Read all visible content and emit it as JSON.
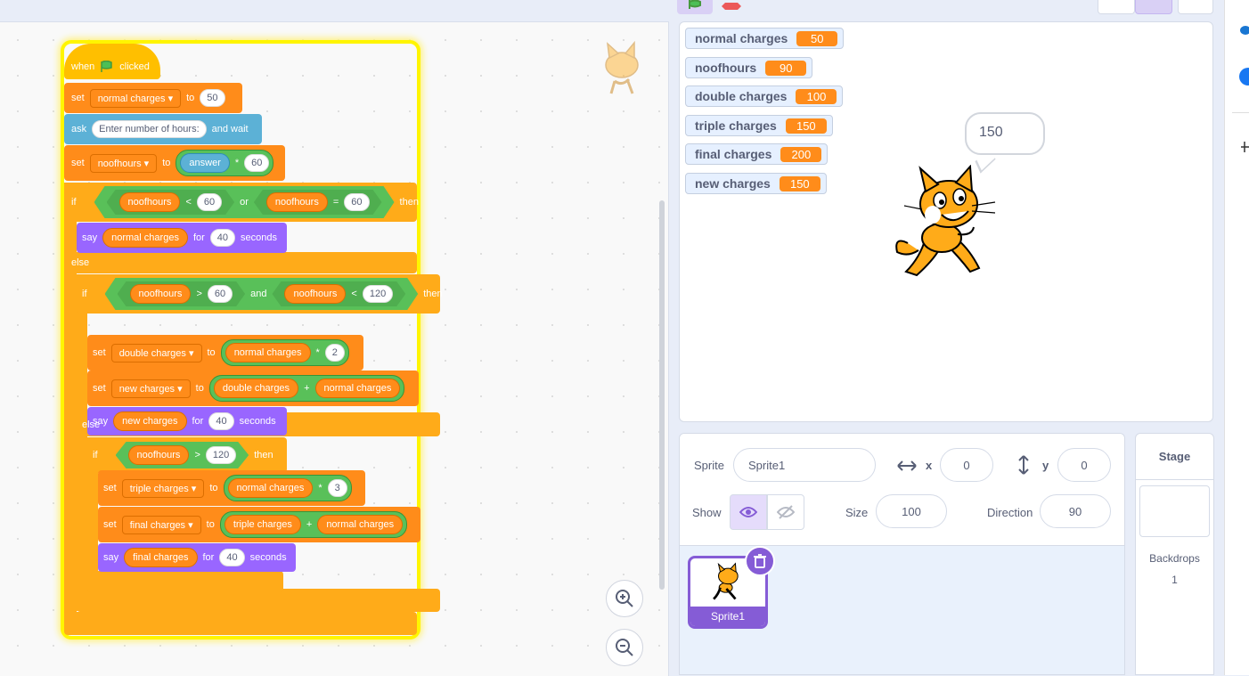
{
  "script": {
    "hat_when": "when",
    "hat_clicked": "clicked",
    "set_kw": "set",
    "to_kw": "to",
    "ask_kw": "ask",
    "and_wait": "and wait",
    "if_kw": "if",
    "then_kw": "then",
    "else_kw": "else",
    "say_kw": "say",
    "for_kw": "for",
    "seconds_kw": "seconds",
    "or_kw": "or",
    "and_kw": "and",
    "lt": "<",
    "gt": ">",
    "eq": "=",
    "mul": "*",
    "plus": "+",
    "var_normal": "normal charges",
    "var_noofhours": "noofhours",
    "var_double": "double charges",
    "var_new": "new charges",
    "var_triple": "triple charges",
    "var_final": "final charges",
    "answer": "answer",
    "ask_prompt": "Enter number of hours:",
    "n50": "50",
    "n60": "60",
    "n40": "40",
    "n120": "120",
    "n2": "2",
    "n3": "3"
  },
  "stage": {
    "monitors": [
      {
        "name": "normal charges",
        "value": "50"
      },
      {
        "name": "noofhours",
        "value": "90"
      },
      {
        "name": "double charges",
        "value": "100"
      },
      {
        "name": "triple charges",
        "value": "150"
      },
      {
        "name": "final charges",
        "value": "200"
      },
      {
        "name": "new charges",
        "value": "150"
      }
    ],
    "bubble": "150"
  },
  "sprite_info": {
    "sprite_label": "Sprite",
    "sprite_name": "Sprite1",
    "x_label": "x",
    "x_value": "0",
    "y_label": "y",
    "y_value": "0",
    "show_label": "Show",
    "size_label": "Size",
    "size_value": "100",
    "direction_label": "Direction",
    "direction_value": "90",
    "tile_name": "Sprite1"
  },
  "stage_pane": {
    "title": "Stage",
    "backdrops_label": "Backdrops",
    "backdrops_count": "1"
  },
  "colors": {
    "events": "#ffbf00",
    "variables": "#ff8c1a",
    "sensing": "#5cb1d6",
    "control": "#ffab19",
    "operators": "#59c059",
    "looks": "#9966ff",
    "accent": "#855cd6"
  }
}
